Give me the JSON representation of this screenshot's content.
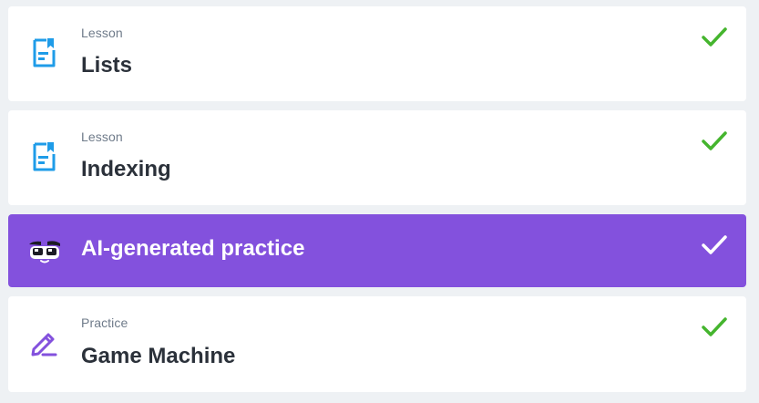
{
  "colors": {
    "page_background": "#eef1f4",
    "card_background": "#ffffff",
    "active_background": "#8351dd",
    "lesson_icon": "#1f9ce8",
    "practice_icon": "#8351dd",
    "check_complete": "#45b52e",
    "check_active": "#ffffff"
  },
  "items": [
    {
      "type": "Lesson",
      "title": "Lists",
      "icon": "document-bookmark-icon",
      "completed": true
    },
    {
      "type": "Lesson",
      "title": "Indexing",
      "icon": "document-bookmark-icon",
      "completed": true
    },
    {
      "type": "",
      "title": "AI-generated practice",
      "icon": "robot-face-icon",
      "completed": true,
      "active": true
    },
    {
      "type": "Practice",
      "title": "Game Machine",
      "icon": "pencil-line-icon",
      "completed": true
    }
  ]
}
